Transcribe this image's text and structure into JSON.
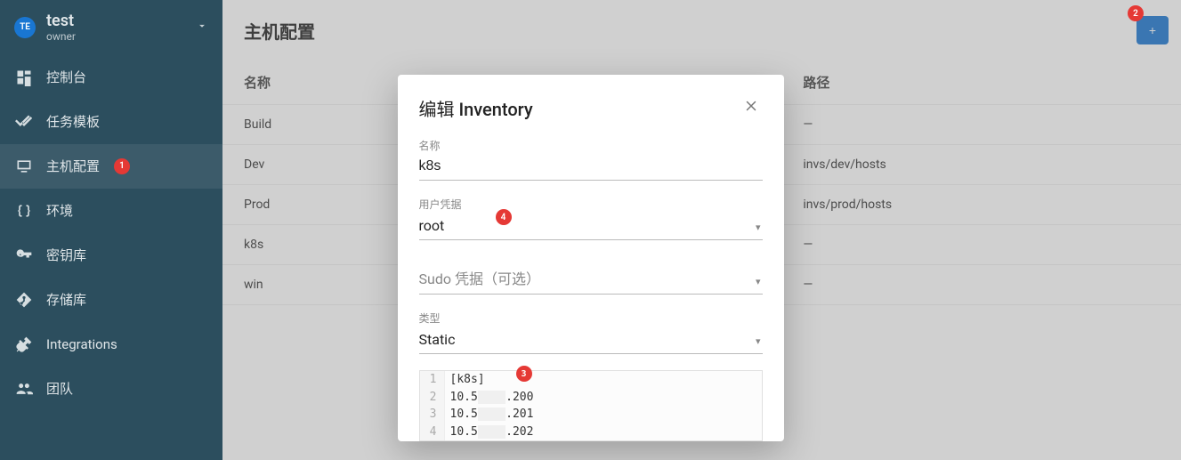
{
  "project": {
    "badge": "TE",
    "name": "test",
    "role": "owner"
  },
  "sidebar": {
    "items": [
      {
        "label": "控制台"
      },
      {
        "label": "任务模板"
      },
      {
        "label": "主机配置"
      },
      {
        "label": "环境"
      },
      {
        "label": "密钥库"
      },
      {
        "label": "存储库"
      },
      {
        "label": "Integrations"
      },
      {
        "label": "团队"
      }
    ]
  },
  "page": {
    "title": "主机配置",
    "new_button": "+"
  },
  "table": {
    "headers": {
      "name": "名称",
      "path": "路径"
    },
    "rows": [
      {
        "name": "Build",
        "path": "—"
      },
      {
        "name": "Dev",
        "path": "invs/dev/hosts"
      },
      {
        "name": "Prod",
        "path": "invs/prod/hosts"
      },
      {
        "name": "k8s",
        "path": "—"
      },
      {
        "name": "win",
        "path": "—"
      }
    ]
  },
  "dialog": {
    "title": "编辑 Inventory",
    "fields": {
      "name_label": "名称",
      "name_value": "k8s",
      "user_cred_label": "用户凭据",
      "user_cred_value": "root",
      "sudo_cred_placeholder": "Sudo 凭据（可选）",
      "type_label": "类型",
      "type_value": "Static"
    },
    "code": {
      "lines": [
        "[k8s]",
        "10.5█.██.200",
        "10.5█.██.201",
        "10.5█.██.202"
      ]
    }
  },
  "annotations": {
    "a1": "1",
    "a2": "2",
    "a3": "3",
    "a4": "4"
  }
}
